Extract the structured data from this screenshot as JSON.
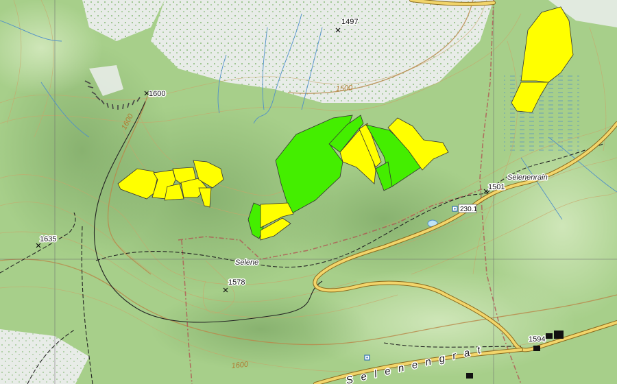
{
  "spot_heights": [
    "1497",
    "1600",
    "1635",
    "1578",
    "1501",
    "1594"
  ],
  "contour_labels": [
    "1500",
    "1600",
    "1600"
  ],
  "place_names": {
    "selene": "Selene",
    "selenenrain": "Selenenrain",
    "selenengrat": "Selenengrat"
  },
  "route_marker": "230.1",
  "colors": {
    "terrain": "#a7cf8a",
    "rock": "#e8ece8",
    "zone_yellow": "#ffff00",
    "zone_green": "#44ee00",
    "water": "#4f8fc9",
    "road": "#f2d56b",
    "contour": "#c9a46a"
  },
  "icons": {
    "summit": "cross-icon",
    "building": "building-icon",
    "route": "signpost-icon"
  }
}
